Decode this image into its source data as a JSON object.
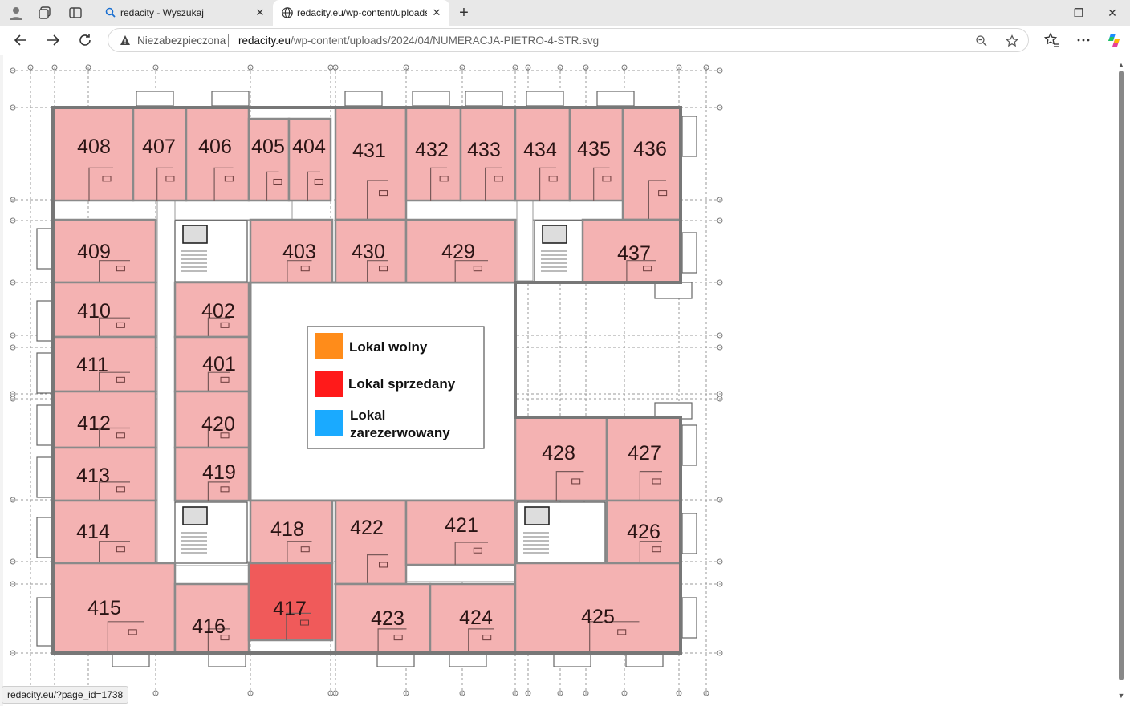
{
  "browser": {
    "tabs": [
      {
        "title": "redacity - Wyszukaj",
        "icon": "search-icon",
        "active": false
      },
      {
        "title": "redacity.eu/wp-content/uploads/",
        "icon": "globe-icon",
        "active": true
      }
    ],
    "address_bar": {
      "security_text": "Niezabezpieczona",
      "url_host": "redacity.eu",
      "url_path": "/wp-content/uploads/2024/04/NUMERACJA-PIETRO-4-STR.svg"
    },
    "status_url": "redacity.eu/?page_id=1738"
  },
  "colors": {
    "unit_fill": "#f4b2b2",
    "sold_fill": "#f05a5a",
    "wall": "#8a8a8a",
    "free": "#ff8c1a",
    "sold": "#ff1a1a",
    "reserved": "#1aaaff"
  },
  "floorplan": {
    "units": [
      {
        "id": "408",
        "status": "available"
      },
      {
        "id": "407",
        "status": "available"
      },
      {
        "id": "406",
        "status": "available"
      },
      {
        "id": "405",
        "status": "available"
      },
      {
        "id": "404",
        "status": "available"
      },
      {
        "id": "431",
        "status": "available"
      },
      {
        "id": "432",
        "status": "available"
      },
      {
        "id": "433",
        "status": "available"
      },
      {
        "id": "434",
        "status": "available"
      },
      {
        "id": "435",
        "status": "available"
      },
      {
        "id": "436",
        "status": "available"
      },
      {
        "id": "409",
        "status": "available"
      },
      {
        "id": "403",
        "status": "available"
      },
      {
        "id": "430",
        "status": "available"
      },
      {
        "id": "429",
        "status": "available"
      },
      {
        "id": "437",
        "status": "available"
      },
      {
        "id": "410",
        "status": "available"
      },
      {
        "id": "402",
        "status": "available"
      },
      {
        "id": "411",
        "status": "available"
      },
      {
        "id": "401",
        "status": "available"
      },
      {
        "id": "412",
        "status": "available"
      },
      {
        "id": "420",
        "status": "available"
      },
      {
        "id": "413",
        "status": "available"
      },
      {
        "id": "419",
        "status": "available"
      },
      {
        "id": "428",
        "status": "available"
      },
      {
        "id": "427",
        "status": "available"
      },
      {
        "id": "414",
        "status": "available"
      },
      {
        "id": "418",
        "status": "available"
      },
      {
        "id": "422",
        "status": "available"
      },
      {
        "id": "421",
        "status": "available"
      },
      {
        "id": "426",
        "status": "available"
      },
      {
        "id": "415",
        "status": "available"
      },
      {
        "id": "416",
        "status": "available"
      },
      {
        "id": "417",
        "status": "sold"
      },
      {
        "id": "423",
        "status": "available"
      },
      {
        "id": "424",
        "status": "available"
      },
      {
        "id": "425",
        "status": "available"
      }
    ],
    "legend": {
      "free_label": "Lokal wolny",
      "sold_label": "Lokal sprzedany",
      "reserved_label_line1": "Lokal",
      "reserved_label_line2": "zarezerwowany"
    }
  }
}
